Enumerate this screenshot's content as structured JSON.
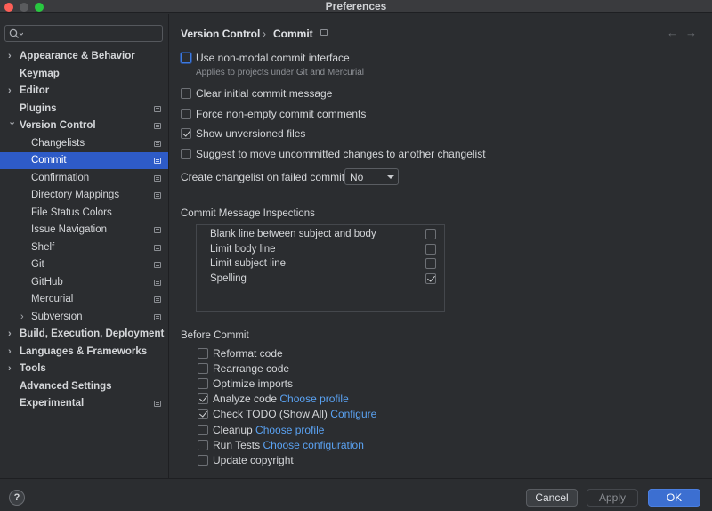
{
  "window": {
    "title": "Preferences"
  },
  "search": {
    "placeholder": "",
    "value": ""
  },
  "sidebar": {
    "items": [
      {
        "label": "Appearance & Behavior",
        "bold": true,
        "expandable": true,
        "expanded": false,
        "indent": 0,
        "badge": false
      },
      {
        "label": "Keymap",
        "bold": true,
        "expandable": false,
        "indent": 0,
        "badge": false
      },
      {
        "label": "Editor",
        "bold": true,
        "expandable": true,
        "expanded": false,
        "indent": 0,
        "badge": false
      },
      {
        "label": "Plugins",
        "bold": true,
        "expandable": false,
        "indent": 0,
        "badge": true
      },
      {
        "label": "Version Control",
        "bold": true,
        "expandable": true,
        "expanded": true,
        "indent": 0,
        "badge": true
      },
      {
        "label": "Changelists",
        "bold": false,
        "expandable": false,
        "indent": 1,
        "badge": true
      },
      {
        "label": "Commit",
        "bold": false,
        "expandable": false,
        "indent": 1,
        "badge": true,
        "selected": true
      },
      {
        "label": "Confirmation",
        "bold": false,
        "expandable": false,
        "indent": 1,
        "badge": true
      },
      {
        "label": "Directory Mappings",
        "bold": false,
        "expandable": false,
        "indent": 1,
        "badge": true
      },
      {
        "label": "File Status Colors",
        "bold": false,
        "expandable": false,
        "indent": 1,
        "badge": false
      },
      {
        "label": "Issue Navigation",
        "bold": false,
        "expandable": false,
        "indent": 1,
        "badge": true
      },
      {
        "label": "Shelf",
        "bold": false,
        "expandable": false,
        "indent": 1,
        "badge": true
      },
      {
        "label": "Git",
        "bold": false,
        "expandable": false,
        "indent": 1,
        "badge": true
      },
      {
        "label": "GitHub",
        "bold": false,
        "expandable": false,
        "indent": 1,
        "badge": true
      },
      {
        "label": "Mercurial",
        "bold": false,
        "expandable": false,
        "indent": 1,
        "badge": true
      },
      {
        "label": "Subversion",
        "bold": false,
        "expandable": true,
        "expanded": false,
        "indent": 1,
        "badge": true
      },
      {
        "label": "Build, Execution, Deployment",
        "bold": true,
        "expandable": true,
        "expanded": false,
        "indent": 0,
        "badge": false
      },
      {
        "label": "Languages & Frameworks",
        "bold": true,
        "expandable": true,
        "expanded": false,
        "indent": 0,
        "badge": false
      },
      {
        "label": "Tools",
        "bold": true,
        "expandable": true,
        "expanded": false,
        "indent": 0,
        "badge": false
      },
      {
        "label": "Advanced Settings",
        "bold": true,
        "expandable": false,
        "indent": 0,
        "badge": false
      },
      {
        "label": "Experimental",
        "bold": true,
        "expandable": false,
        "indent": 0,
        "badge": true
      }
    ]
  },
  "breadcrumb": {
    "parent": "Version Control",
    "separator": "›",
    "current": "Commit"
  },
  "options": [
    {
      "label": "Use non-modal commit interface",
      "checked": false,
      "focused": true
    },
    {
      "label": "Clear initial commit message",
      "checked": false
    },
    {
      "label": "Force non-empty commit comments",
      "checked": false
    },
    {
      "label": "Show unversioned files",
      "checked": true
    },
    {
      "label": "Suggest to move uncommitted changes to another changelist",
      "checked": false
    }
  ],
  "non_modal_hint": "Applies to projects under Git and Mercurial",
  "failed_commit": {
    "label": "Create changelist on failed commit:",
    "value": "No"
  },
  "inspections": {
    "title": "Commit Message Inspections",
    "items": [
      {
        "label": "Blank line between subject and body",
        "checked": false
      },
      {
        "label": "Limit body line",
        "checked": false
      },
      {
        "label": "Limit subject line",
        "checked": false
      },
      {
        "label": "Spelling",
        "checked": true
      }
    ]
  },
  "before_commit": {
    "title": "Before Commit",
    "items": [
      {
        "label": "Reformat code",
        "checked": false,
        "link": ""
      },
      {
        "label": "Rearrange code",
        "checked": false,
        "link": ""
      },
      {
        "label": "Optimize imports",
        "checked": false,
        "link": ""
      },
      {
        "label": "Analyze code",
        "checked": true,
        "link": "Choose profile"
      },
      {
        "label": "Check TODO (Show All)",
        "checked": true,
        "link": "Configure"
      },
      {
        "label": "Cleanup",
        "checked": false,
        "link": "Choose profile"
      },
      {
        "label": "Run Tests",
        "checked": false,
        "link": "Choose configuration"
      },
      {
        "label": "Update copyright",
        "checked": false,
        "link": ""
      }
    ]
  },
  "footer": {
    "help": "?",
    "cancel": "Cancel",
    "apply": "Apply",
    "ok": "OK"
  },
  "colors": {
    "accent": "#3c6fd1",
    "selection": "#2e5bc7",
    "link": "#5aa2f2",
    "background": "#2b2d30"
  }
}
